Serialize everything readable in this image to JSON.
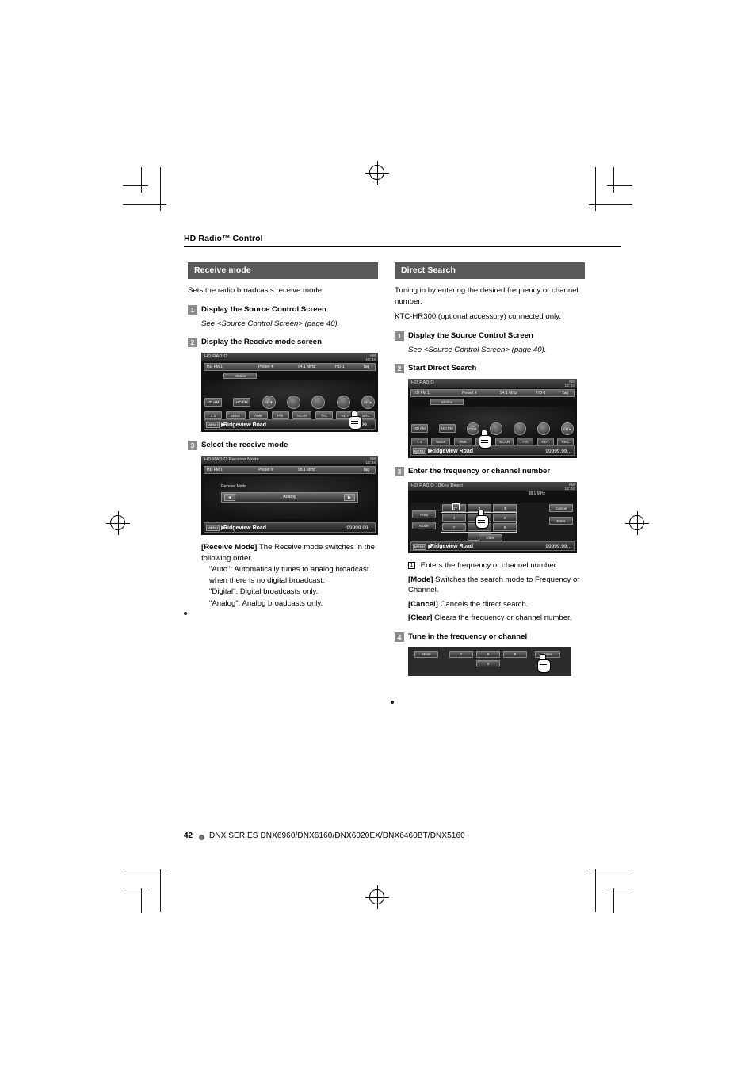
{
  "document": {
    "chapter_title": "HD Radio™ Control",
    "page_number": "42",
    "footer_models": "DNX SERIES  DNX6960/DNX6160/DNX6020EX/DNX6460BT/DNX5160"
  },
  "left_column": {
    "section_title": "Receive mode",
    "intro": "Sets the radio broadcasts receive mode.",
    "steps": [
      {
        "num": "1",
        "title": "Display the Source Control Screen",
        "note": "See <Source Control Screen> (page 40)."
      },
      {
        "num": "2",
        "title": "Display the Receive mode screen"
      },
      {
        "num": "3",
        "title": "Select the receive mode"
      }
    ],
    "definitions": [
      {
        "term": "[Receive Mode]",
        "desc": "The Receive mode switches in the following order."
      },
      {
        "term": "\"Auto\":",
        "desc": "Automatically tunes to analog broadcast when there is no digital broadcast."
      },
      {
        "term": "\"Digital\":",
        "desc": "Digital broadcasts only."
      },
      {
        "term": "\"Analog\":",
        "desc": "Analog broadcasts only."
      }
    ],
    "screen1": {
      "header": "HD RADIO",
      "header_right": "AM\n12:34",
      "info": {
        "left": "HD FM 1",
        "mid": "Preset  4",
        "freq": "94.1  MHz",
        "right": "HD-1",
        "tag": "Tag"
      },
      "subtab": "Station",
      "buttons_row1": [
        "HD AM",
        "HD FM",
        "CH▼",
        "",
        "",
        "",
        "CH▲"
      ],
      "buttons_row2": [
        "1 2",
        "SEEK",
        "AME",
        "P/S",
        "SCAN",
        "TTL",
        "RDY",
        "SRC"
      ],
      "bottom": {
        "menu": "MENU",
        "road": "Ridgeview Road",
        "freq": "99.…"
      }
    },
    "screen2": {
      "header": "HD RADIO Receive Mode",
      "header_right": "AM\n12:34",
      "info": {
        "left": "HD FM 1",
        "mid": "Preset  #",
        "freq": "98.1  MHz",
        "right": "",
        "tag": "Tag"
      },
      "label": "Receive Mode",
      "value": "Analog",
      "bottom": {
        "menu": "MENU",
        "road": "Ridgeview Road",
        "freq": "99999.99…"
      }
    }
  },
  "right_column": {
    "section_title": "Direct Search",
    "intro": "Tuning in by entering the desired frequency or channel number.",
    "note": "KTC-HR300 (optional accessory) connected only.",
    "steps": [
      {
        "num": "1",
        "title": "Display the Source Control Screen",
        "note": "See <Source Control Screen> (page 40)."
      },
      {
        "num": "2",
        "title": "Start Direct Search"
      },
      {
        "num": "3",
        "title": "Enter the frequency or channel number"
      },
      {
        "num": "4",
        "title": "Tune in the frequency or channel"
      }
    ],
    "definitions": [
      {
        "marker": "1",
        "desc": "Enters the frequency or channel number."
      },
      {
        "term": "[Mode]",
        "desc": "Switches the search mode to Frequency or Channel."
      },
      {
        "term": "[Cancel]",
        "desc": "Cancels the direct search."
      },
      {
        "term": "[Clear]",
        "desc": "Clears the frequency or channel number."
      }
    ],
    "screen1": {
      "header": "HD RADIO",
      "header_right": "AM\n12:34",
      "info": {
        "left": "HD FM 1",
        "mid": "Preset  4",
        "freq": "94.1  MHz",
        "right": "HD-1",
        "tag": "Tag"
      },
      "subtab": "Station",
      "buttons_row1": [
        "HD AM",
        "HD FM",
        "CH▼",
        "",
        "",
        "",
        "CH▲"
      ],
      "buttons_row2": [
        "1 2",
        "SEEK",
        "AME",
        "P/S",
        "SCAN",
        "TTL",
        "RDY",
        "SRC"
      ],
      "bottom": {
        "menu": "MENU",
        "road": "Ridgeview Road",
        "freq": "99999.99…"
      }
    },
    "screen2": {
      "header": "HD RADIO 10Key Direct",
      "header_right": "AM\n12:34",
      "info": {
        "freq": "98.1  MHz"
      },
      "side_buttons": [
        "Cancel",
        "Enter"
      ],
      "left_buttons": [
        "Freq",
        "Mode"
      ],
      "keys": [
        "1",
        "2",
        "3",
        "4",
        "5",
        "6",
        "7",
        "8",
        "9",
        "",
        "0",
        ""
      ],
      "clear_label": "Clear",
      "bottom": {
        "menu": "MENU",
        "road": "Ridgeview Road",
        "freq": "99999.99…"
      }
    },
    "screen3": {
      "left_button": "Mode",
      "keys": [
        "7",
        "8",
        "9",
        "0"
      ],
      "enter": "Enter"
    }
  }
}
